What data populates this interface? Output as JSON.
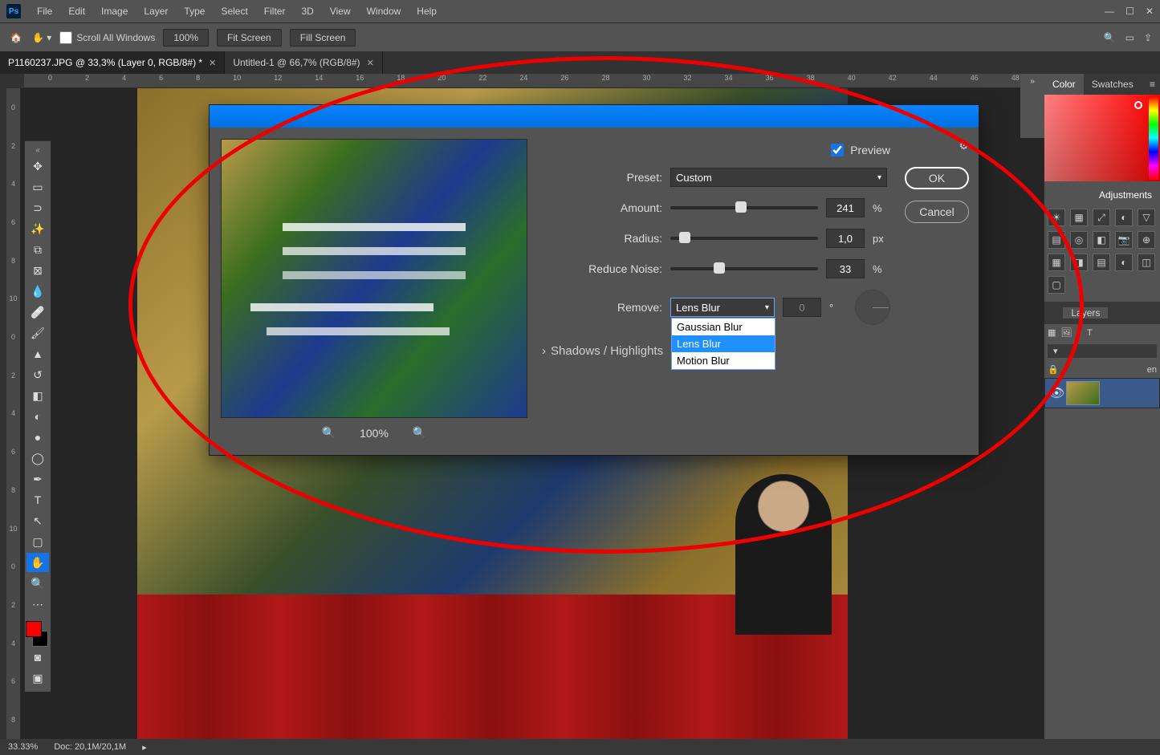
{
  "menu": {
    "items": [
      "File",
      "Edit",
      "Image",
      "Layer",
      "Type",
      "Select",
      "Filter",
      "3D",
      "View",
      "Window",
      "Help"
    ]
  },
  "options": {
    "scroll_all": "Scroll All Windows",
    "zoom": "100%",
    "fit": "Fit Screen",
    "fill": "Fill Screen"
  },
  "tabs": {
    "active": "P1160237.JPG @ 33,3% (Layer 0, RGB/8#) *",
    "other": "Untitled-1 @ 66,7% (RGB/8#)"
  },
  "ruler": {
    "marks": [
      "0",
      "2",
      "4",
      "6",
      "8",
      "10",
      "12",
      "14",
      "16",
      "18",
      "20",
      "22",
      "24",
      "26",
      "28",
      "30",
      "32",
      "34",
      "36",
      "38",
      "40",
      "42",
      "44",
      "46",
      "48"
    ],
    "vmarks": [
      "0",
      "2",
      "4",
      "6",
      "8",
      "10",
      "0",
      "2",
      "4",
      "6",
      "8",
      "10",
      "0",
      "2",
      "4",
      "6",
      "8"
    ]
  },
  "dialog": {
    "preview_label": "Preview",
    "preset_label": "Preset:",
    "preset_value": "Custom",
    "amount_label": "Amount:",
    "amount_value": "241",
    "amount_unit": "%",
    "radius_label": "Radius:",
    "radius_value": "1,0",
    "radius_unit": "px",
    "noise_label": "Reduce Noise:",
    "noise_value": "33",
    "noise_unit": "%",
    "remove_label": "Remove:",
    "remove_value": "Lens Blur",
    "remove_options": {
      "opt1": "Gaussian Blur",
      "opt2": "Lens Blur",
      "opt3": "Motion Blur"
    },
    "angle_value": "0",
    "shadows_label": "Shadows / Highlights",
    "ok": "OK",
    "cancel": "Cancel",
    "zoom_label": "100%"
  },
  "right": {
    "color_tab": "Color",
    "swatches_tab": "Swatches",
    "adjust": "Adjustments",
    "layers_tab": "Layers",
    "layer_prefix": "en"
  },
  "status": {
    "zoom": "33.33%",
    "doc": "Doc: 20,1M/20,1M"
  }
}
